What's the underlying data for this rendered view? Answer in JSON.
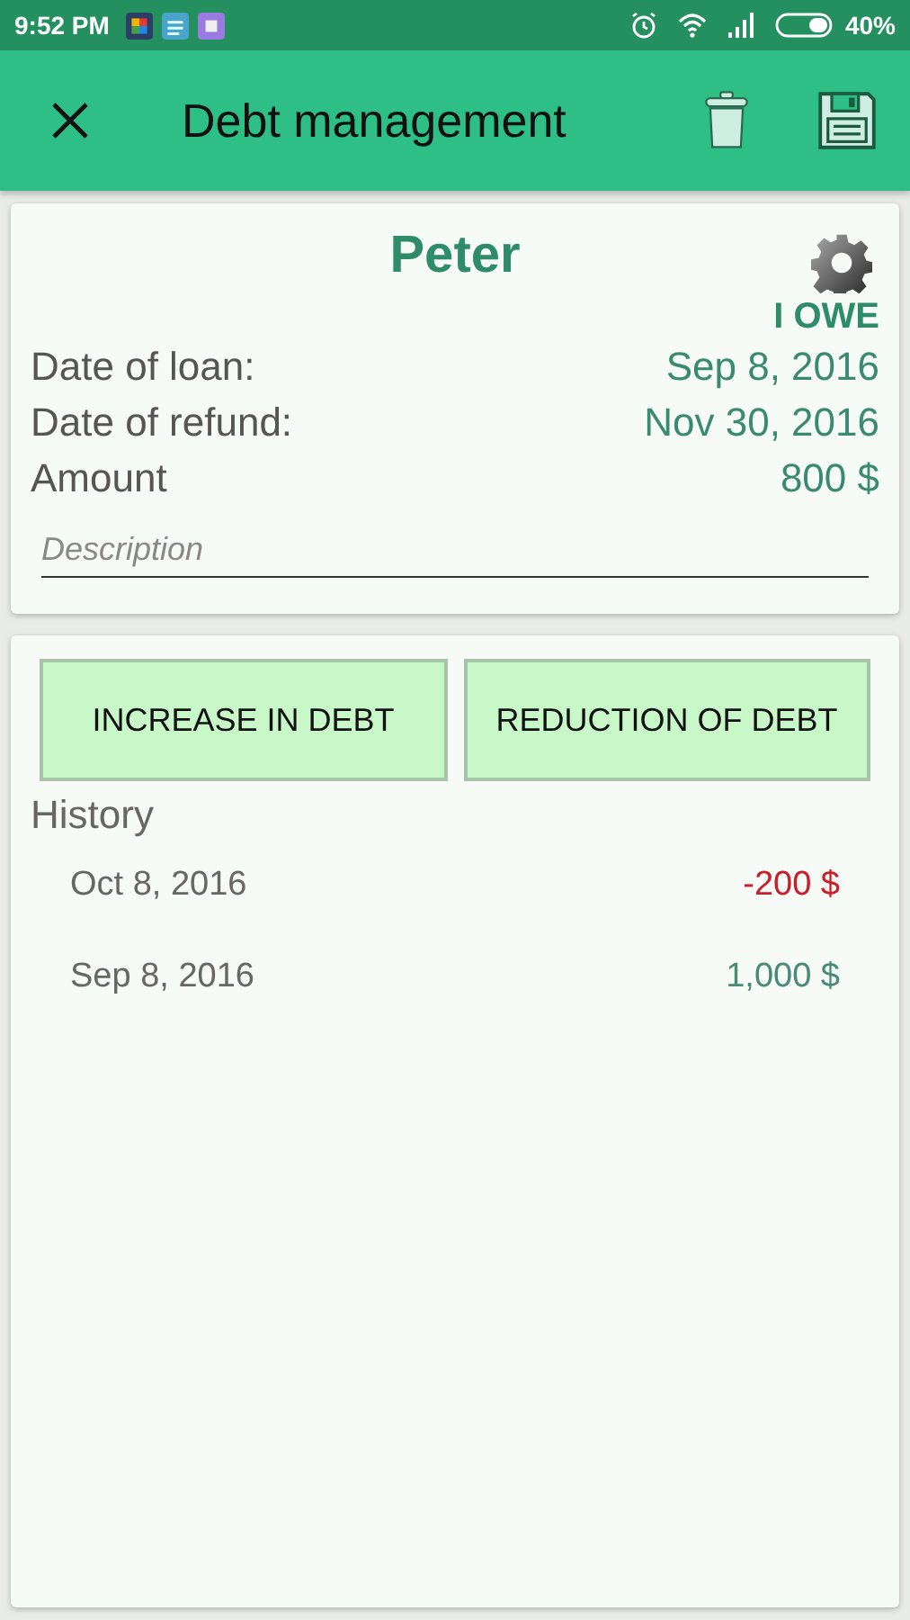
{
  "status_bar": {
    "time": "9:52 PM",
    "battery": "40%"
  },
  "app_bar": {
    "title": "Debt management"
  },
  "debt": {
    "name": "Peter",
    "direction": "I OWE",
    "fields": [
      {
        "label": "Date of loan:",
        "value": "Sep 8, 2016"
      },
      {
        "label": "Date of refund:",
        "value": "Nov 30, 2016"
      },
      {
        "label": "Amount",
        "value": "800 $"
      }
    ],
    "description": {
      "placeholder": "Description"
    }
  },
  "buttons": [
    "INCREASE IN DEBT",
    "REDUCTION OF DEBT"
  ],
  "history": {
    "title": "History",
    "entries": [
      {
        "date": "Oct 8, 2016",
        "amount": "-200 $",
        "color": "#c8202a"
      },
      {
        "date": "Sep 8, 2016",
        "amount": "1,000 $",
        "color": "#4a8a78"
      }
    ]
  }
}
